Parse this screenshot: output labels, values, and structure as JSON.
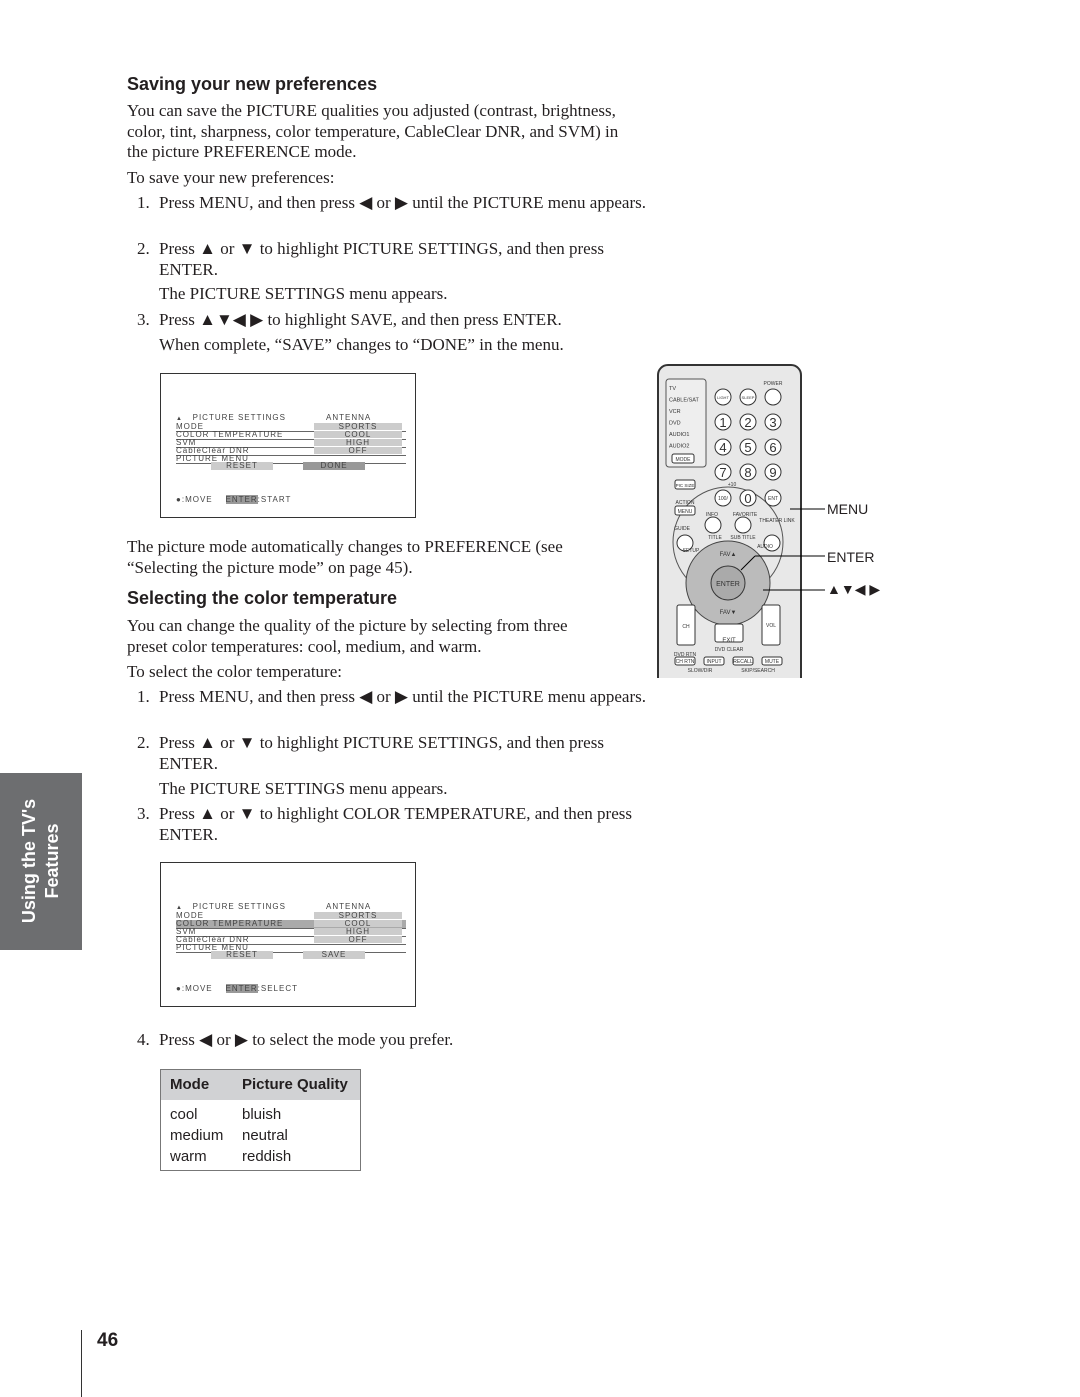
{
  "section1": {
    "heading": "Saving your new preferences",
    "intro": "You can save the PICTURE qualities you adjusted (contrast, brightness, color, tint, sharpness, color temperature, CableClear DNR, and SVM) in the picture PREFERENCE mode.",
    "lead": "To save your new preferences:",
    "steps": [
      {
        "n": "1.",
        "text": "Press MENU, and then press ◀ or ▶ until the PICTURE menu appears."
      },
      {
        "n": "2.",
        "text": "Press ▲ or ▼ to highlight PICTURE SETTINGS, and then press ENTER."
      },
      {
        "n": "3.",
        "text": "Press ▲▼◀ ▶ to highlight SAVE, and then press ENTER."
      }
    ],
    "note2": "The PICTURE SETTINGS menu appears.",
    "note3": "When complete, “SAVE” changes to “DONE” in the menu.",
    "after": "The picture mode automatically changes to PREFERENCE (see “Selecting the picture mode” on page 45)."
  },
  "menu1": {
    "title": "PICTURE SETTINGS",
    "source": "ANTENNA",
    "rows": [
      {
        "label": "MODE",
        "value": "SPORTS"
      },
      {
        "label": "COLOR TEMPERATURE",
        "value": "COOL"
      },
      {
        "label": "SVM",
        "value": "HIGH"
      },
      {
        "label": "CableClear DNR",
        "value": "OFF"
      },
      {
        "label": "PICTURE MENU",
        "value": ""
      }
    ],
    "reset": "RESET",
    "action": "DONE",
    "move": ":MOVE",
    "enter": "ENTER",
    "enter_action": ":START"
  },
  "section2": {
    "heading": "Selecting the color temperature",
    "intro": "You can change the quality of the picture by selecting from three preset color temperatures: cool, medium, and warm.",
    "lead": "To select the color temperature:",
    "steps": [
      {
        "n": "1.",
        "text": "Press MENU, and then press ◀ or ▶ until the PICTURE menu appears."
      },
      {
        "n": "2.",
        "text": "Press ▲ or ▼ to highlight PICTURE SETTINGS, and then press ENTER."
      },
      {
        "n": "3.",
        "text": "Press ▲ or ▼ to highlight COLOR TEMPERATURE, and then press ENTER."
      },
      {
        "n": "4.",
        "text": "Press ◀ or ▶ to select the mode you prefer."
      }
    ],
    "note2": "The PICTURE SETTINGS menu appears."
  },
  "menu2": {
    "title": "PICTURE SETTINGS",
    "source": "ANTENNA",
    "rows": [
      {
        "label": "MODE",
        "value": "SPORTS"
      },
      {
        "label": "COLOR TEMPERATURE",
        "value": "COOL"
      },
      {
        "label": "SVM",
        "value": "HIGH"
      },
      {
        "label": "CableClear DNR",
        "value": "OFF"
      },
      {
        "label": "PICTURE MENU",
        "value": ""
      }
    ],
    "reset": "RESET",
    "action": "SAVE",
    "move": ":MOVE",
    "enter": "ENTER",
    "enter_action": ":SELECT"
  },
  "table": {
    "headers": [
      "Mode",
      "Picture Quality"
    ],
    "rows": [
      [
        "cool",
        "bluish"
      ],
      [
        "medium",
        "neutral"
      ],
      [
        "warm",
        "reddish"
      ]
    ]
  },
  "remote": {
    "callouts": [
      "MENU",
      "ENTER",
      "▲▼◀ ▶"
    ],
    "sources": [
      "TV",
      "CABLE/SAT",
      "VCR",
      "DVD",
      "AUDIO1",
      "AUDIO2"
    ],
    "mode": "MODE",
    "power": "POWER",
    "light": "LIGHT",
    "sleep": "SLEEP",
    "digits": [
      "1",
      "2",
      "3",
      "4",
      "5",
      "6",
      "7",
      "8",
      "9"
    ],
    "zero": "0",
    "hundred": "100/",
    "plus10": "+10",
    "ent": "ENT",
    "picsize": "PIC SIZE",
    "action": "ACTION",
    "menu": "MENU",
    "info": "INFO",
    "favorite": "FAVORITE",
    "theater": "THEATER LINK",
    "guide": "GUIDE",
    "title": "TITLE",
    "subtitle": "SUB TITLE",
    "audio": "AUDIO",
    "setup": "SETUP",
    "favup": "FAV▲",
    "favdown": "FAV▼",
    "enter": "ENTER",
    "ch": "CH",
    "vol": "VOL",
    "exit": "EXIT",
    "dvdclear": "DVD CLEAR",
    "dvdrtn": "DVD RTN",
    "chrtn": "CH RTN",
    "input": "INPUT",
    "recall": "RECALL",
    "mute": "MUTE",
    "slowdir": "SLOW/DIR",
    "skipsearch": "SKIP/SEARCH"
  },
  "sidetab": {
    "line1": "Using the TV's",
    "line2": "Features"
  },
  "page_number": "46"
}
